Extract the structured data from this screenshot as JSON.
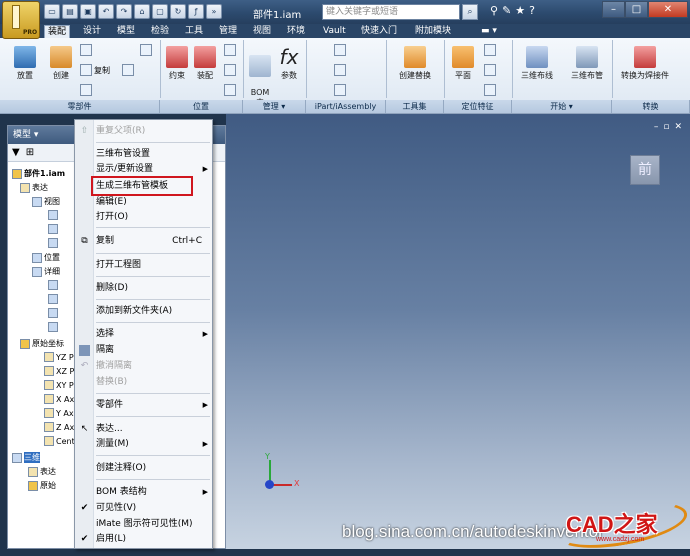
{
  "titlebar": {
    "document_title": "部件1.iam",
    "search_placeholder": "键入关键字或短语",
    "logo_text": "PRO",
    "help_label": "?"
  },
  "tabs": [
    "装配",
    "设计",
    "模型",
    "检验",
    "工具",
    "管理",
    "视图",
    "环境",
    "Vault",
    "快速入门",
    "附加模块"
  ],
  "active_tab": "装配",
  "ribbon": {
    "buttons": {
      "place": "放置",
      "create": "创建",
      "copy": "复制",
      "constraint": "约束",
      "assemble": "装配",
      "bom": "BOM\n表",
      "params": "参数",
      "create_replace": "创建替换",
      "plane": "平面",
      "route_3d": "三维布线",
      "pipe_3d": "三维布管",
      "convert_weld": "转换为焊接件"
    },
    "panels": [
      "零部件",
      "位置",
      "管理 ▾",
      "iPart/iAssembly",
      "工具集",
      "定位特征",
      "开始 ▾",
      "转换"
    ]
  },
  "browser": {
    "header": "模型 ▾",
    "rows": [
      "部件1.iam",
      "表达",
      "视图",
      "位置",
      "详细",
      "原始坐标",
      "YZ P",
      "XZ P",
      "XY P",
      "X Ax",
      "Y Ax",
      "Z Ax",
      "Cent",
      "三维",
      "表达",
      "原始"
    ]
  },
  "context_menu": {
    "items": [
      {
        "label": "重复父项(R)",
        "disabled": true
      },
      {
        "label": "三维布管设置"
      },
      {
        "label": "显示/更新设置",
        "submenu": true
      },
      {
        "label": "生成三维布管模板",
        "highlighted": true
      },
      {
        "label": "编辑(E)"
      },
      {
        "label": "打开(O)"
      },
      {
        "label": "复制",
        "shortcut": "Ctrl+C"
      },
      {
        "label": "打开工程图"
      },
      {
        "label": "删除(D)"
      },
      {
        "label": "添加到新文件夹(A)"
      },
      {
        "label": "选择",
        "submenu": true
      },
      {
        "label": "隔离"
      },
      {
        "label": "撤消隔离",
        "disabled": true
      },
      {
        "label": "替换(B)",
        "disabled": true
      },
      {
        "label": "零部件",
        "submenu": true
      },
      {
        "label": "表达..."
      },
      {
        "label": "测量(M)",
        "submenu": true
      },
      {
        "label": "创建注释(O)"
      },
      {
        "label": "BOM 表结构",
        "submenu": true
      },
      {
        "label": "可见性(V)",
        "checked": true
      },
      {
        "label": "iMate 图示符可见性(M)"
      },
      {
        "label": "启用(L)",
        "checked": true
      }
    ]
  },
  "viewport": {
    "viewcube_label": "前",
    "axis_x": "X",
    "axis_y": "Y"
  },
  "watermark": {
    "text": "blog.sina.com.cn/autodeskinventor",
    "brand": "CAD之家",
    "brand_url": "www.cadzj.com"
  },
  "colors": {
    "highlight_box": "#d0161e",
    "titlebar": "#2c4a6e",
    "ribbon": "#e7eef6"
  }
}
